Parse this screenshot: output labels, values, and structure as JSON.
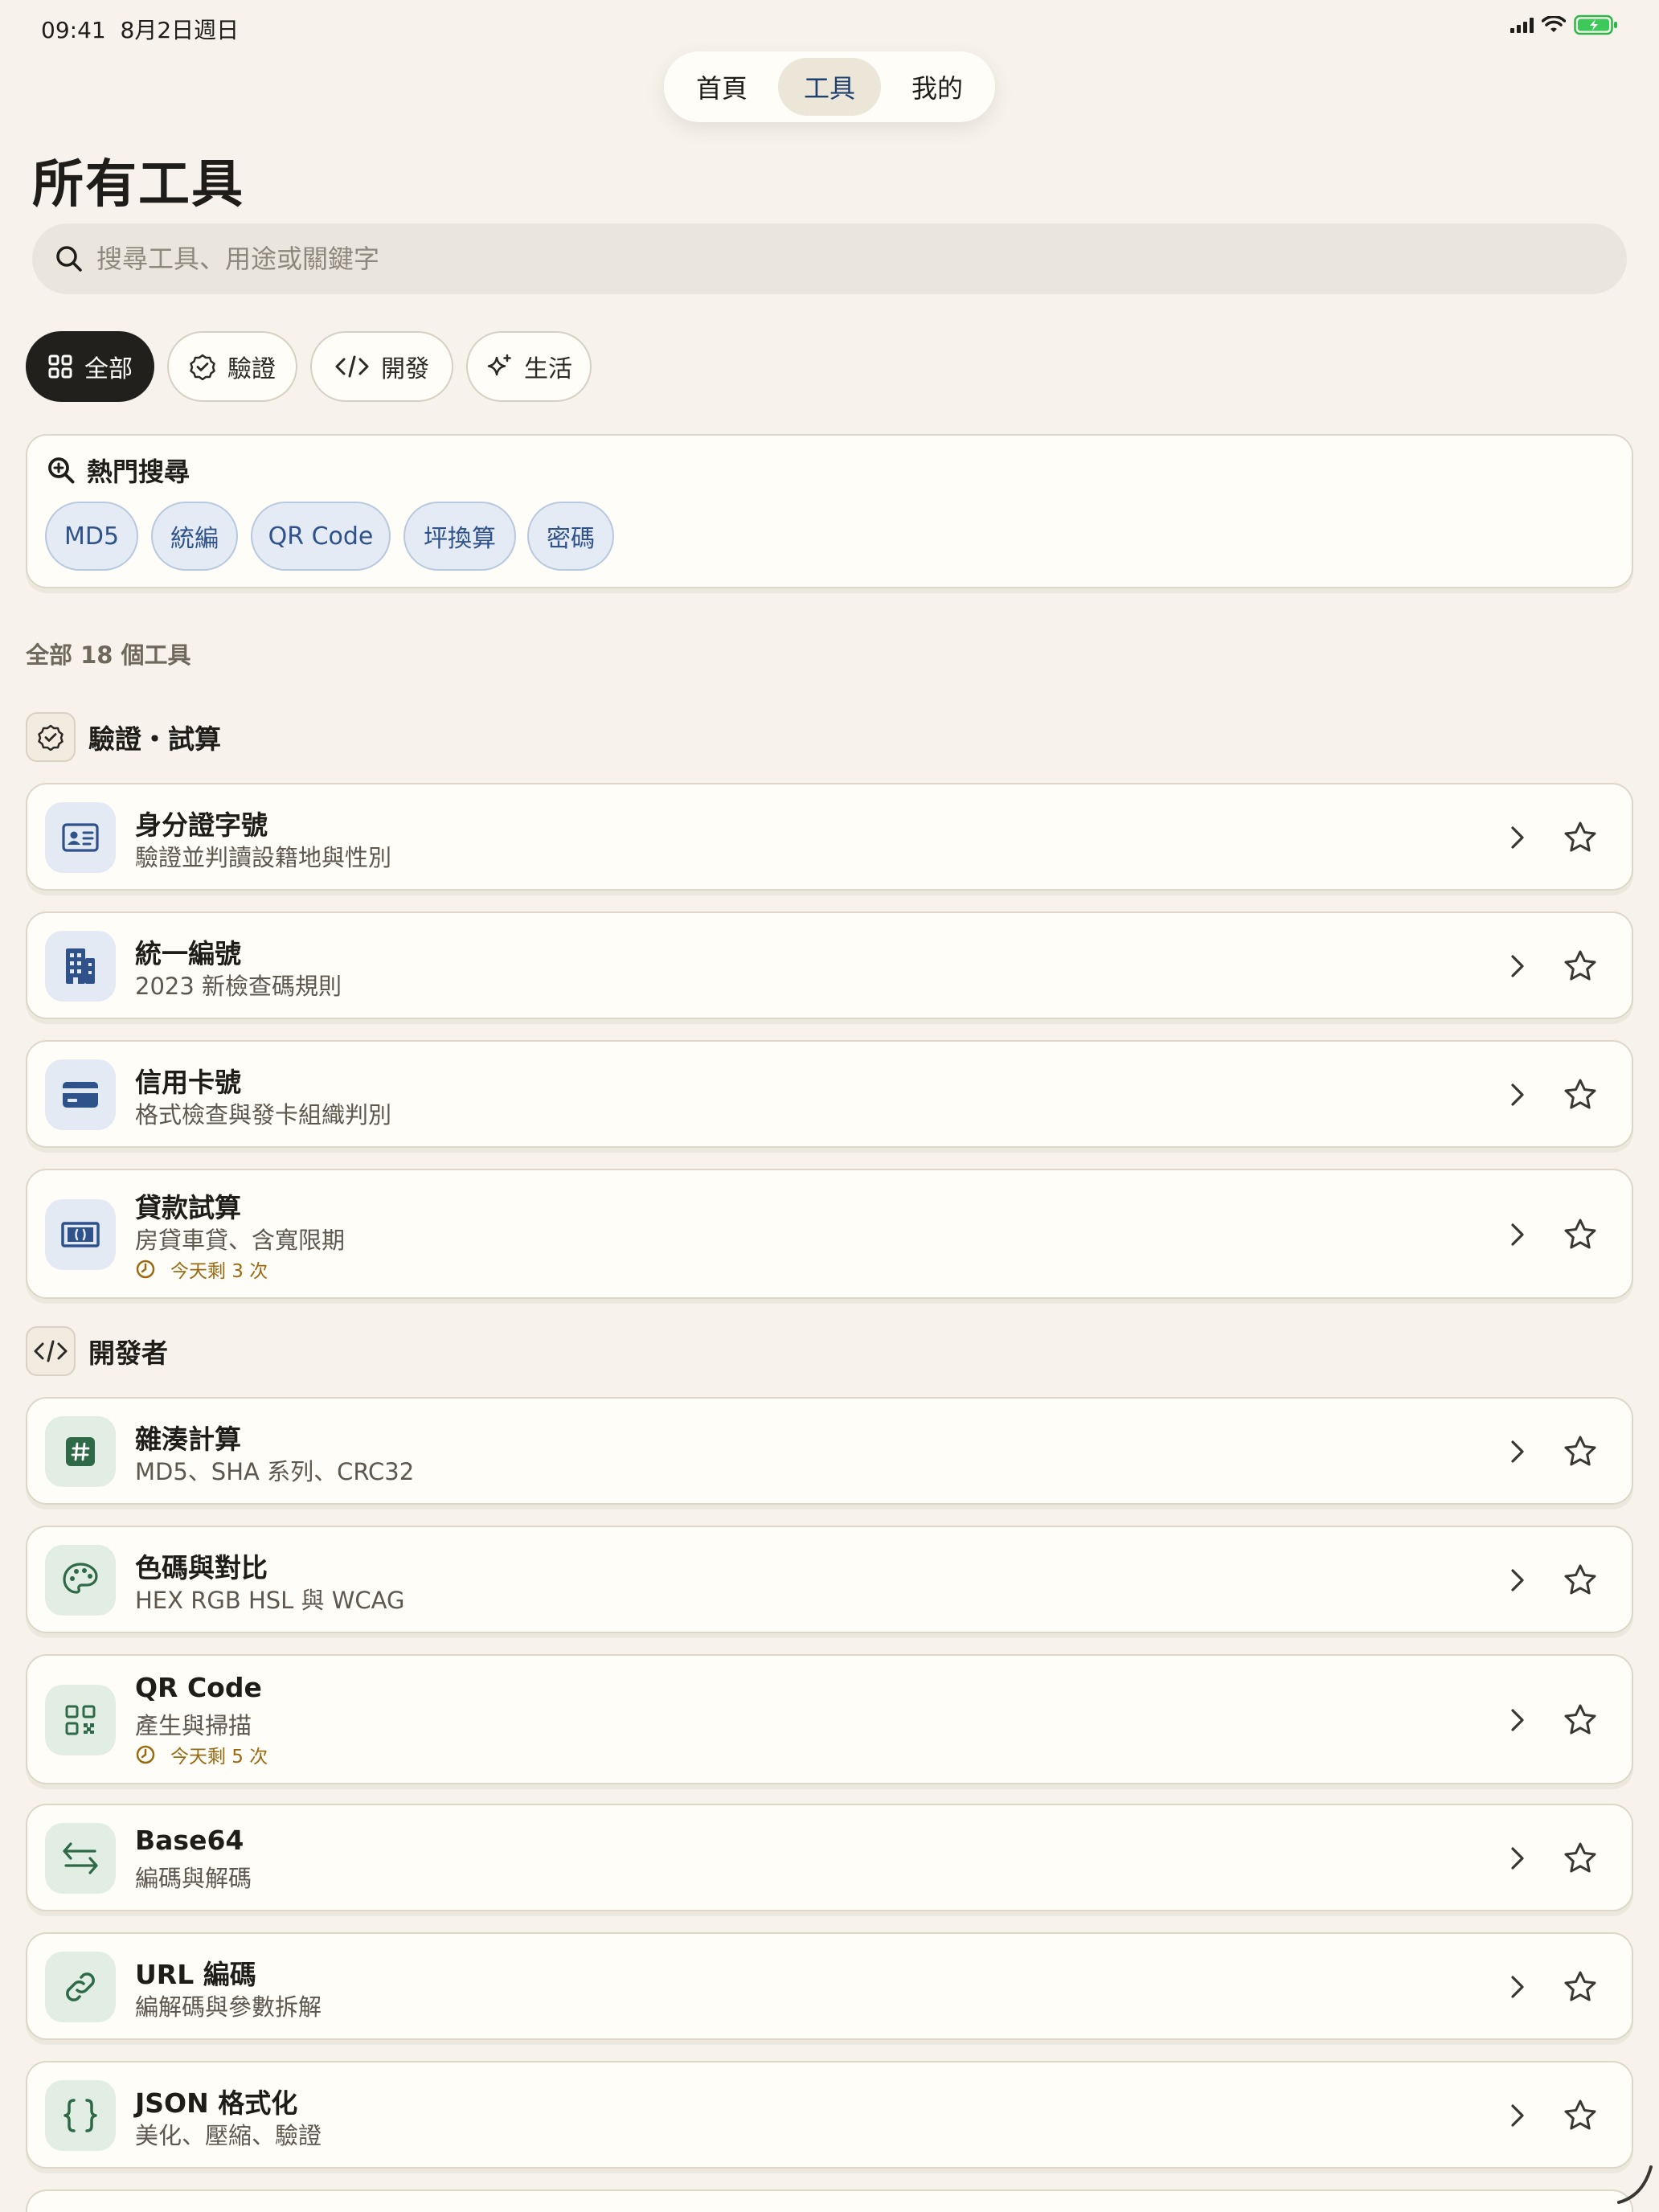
{
  "status_bar": {
    "time": "09:41",
    "date": "8月2日週日"
  },
  "nav": {
    "tabs": [
      {
        "label": "首頁"
      },
      {
        "label": "工具"
      },
      {
        "label": "我的"
      }
    ],
    "active": "工具"
  },
  "page": {
    "title": "所有工具"
  },
  "search": {
    "placeholder": "搜尋工具、用途或關鍵字",
    "value": ""
  },
  "filters": [
    {
      "label": "全部",
      "icon": "grid-icon",
      "active": true
    },
    {
      "label": "驗證",
      "icon": "check-badge-icon",
      "active": false
    },
    {
      "label": "開發",
      "icon": "code-icon",
      "active": false
    },
    {
      "label": "生活",
      "icon": "sparkle-icon",
      "active": false
    }
  ],
  "hot_search": {
    "title": "熱門搜尋",
    "tags": [
      "MD5",
      "統編",
      "QR Code",
      "坪換算",
      "密碼"
    ]
  },
  "summary": {
    "count_text": "全部 18 個工具"
  },
  "sections": [
    {
      "title": "驗證・試算",
      "icon": "check-badge-icon",
      "tools": [
        {
          "title": "身分證字號",
          "desc": "驗證並判讀設籍地與性別",
          "icon": "id-card-icon"
        },
        {
          "title": "統一編號",
          "desc": "2023 新檢查碼規則",
          "icon": "building-icon"
        },
        {
          "title": "信用卡號",
          "desc": "格式檢查與發卡組織判別",
          "icon": "credit-card-icon"
        },
        {
          "title": "貸款試算",
          "desc": "房貸車貸、含寬限期",
          "icon": "banknote-icon",
          "quota": "今天剩 3 次"
        }
      ]
    },
    {
      "title": "開發者",
      "icon": "code-icon",
      "tools": [
        {
          "title": "雜湊計算",
          "desc": "MD5、SHA 系列、CRC32",
          "icon": "hash-icon"
        },
        {
          "title": "色碼與對比",
          "desc": "HEX RGB HSL 與 WCAG",
          "icon": "palette-icon"
        },
        {
          "title": "QR Code",
          "desc": "產生與掃描",
          "icon": "qr-icon",
          "quota": "今天剩 5 次"
        },
        {
          "title": "Base64",
          "desc": "編碼與解碼",
          "icon": "swap-arrows-icon"
        },
        {
          "title": "URL 編碼",
          "desc": "編解碼與參數拆解",
          "icon": "link-icon"
        },
        {
          "title": "JSON 格式化",
          "desc": "美化、壓縮、驗證",
          "icon": "braces-icon"
        }
      ]
    }
  ],
  "colors": {
    "accent_blue": "#2e5289",
    "accent_green": "#2f6a48",
    "quota": "#9a6a12",
    "background": "#f7f3ec"
  }
}
